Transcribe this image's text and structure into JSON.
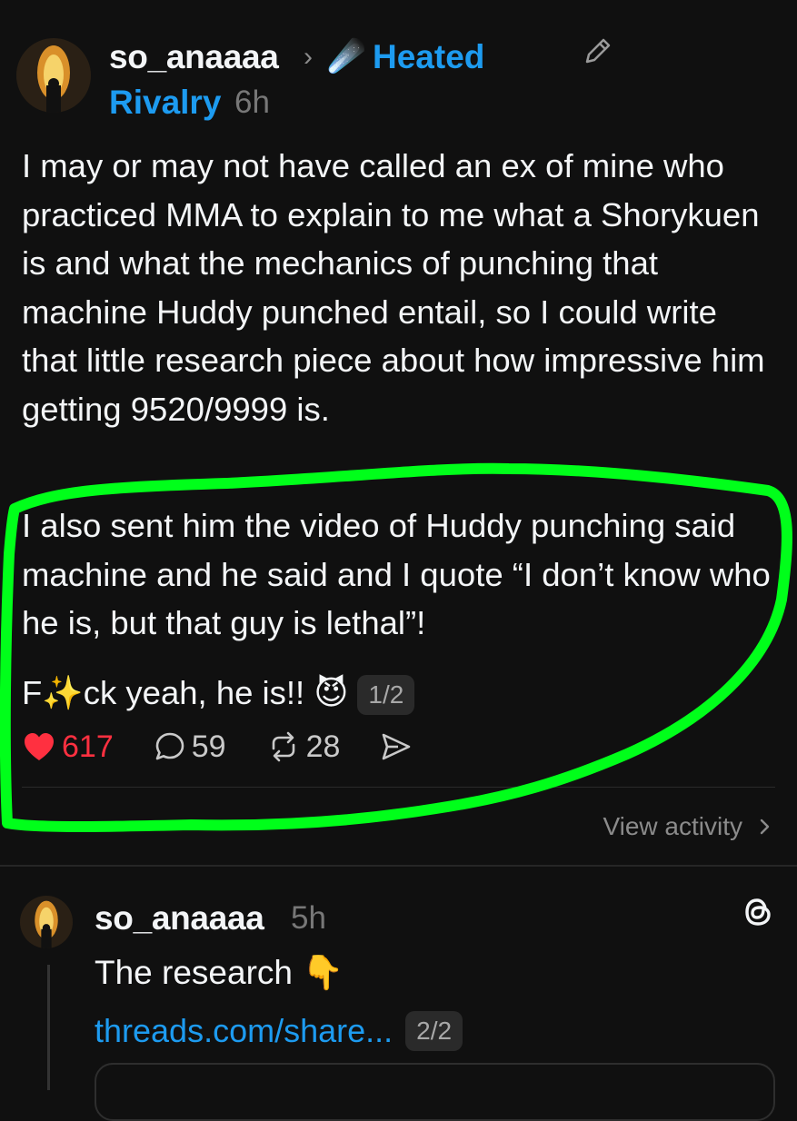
{
  "post": {
    "username": "so_anaaaa",
    "separator": "›",
    "topic_emoji": "☄️",
    "topic_line1": "Heated",
    "topic_line2": "Rivalry",
    "time": "6h",
    "paragraph1": "I may or may not have called an ex of mine who practiced MMA to explain to me what a Shorykuen is and what the mechanics of punching that machine Huddy punched entail, so I could write that little research piece about how impressive him getting 9520/9999 is.",
    "paragraph2": "I also sent him the video of Huddy punching said machine and he said and I quote “I don’t know who he is, but that guy is lethal”!",
    "paragraph3_a": "F",
    "paragraph3_sparkle": "✨",
    "paragraph3_b": "ck yeah, he is!! 😈",
    "page_indicator": "1/2",
    "likes": "617",
    "replies": "59",
    "reposts": "28",
    "view_activity": "View activity"
  },
  "reply": {
    "username": "so_anaaaa",
    "time": "5h",
    "text": "The research 👇",
    "link": "threads.com/share...",
    "page_indicator": "2/2"
  },
  "colors": {
    "background": "#101010",
    "link_blue": "#1d9bf0",
    "like_red": "#ff3040",
    "annotation_green": "#00ff1a"
  },
  "icons": [
    "pencil-icon",
    "heart-icon",
    "reply-icon",
    "repost-icon",
    "share-icon",
    "chevron-right-icon",
    "threads-logo-icon"
  ]
}
